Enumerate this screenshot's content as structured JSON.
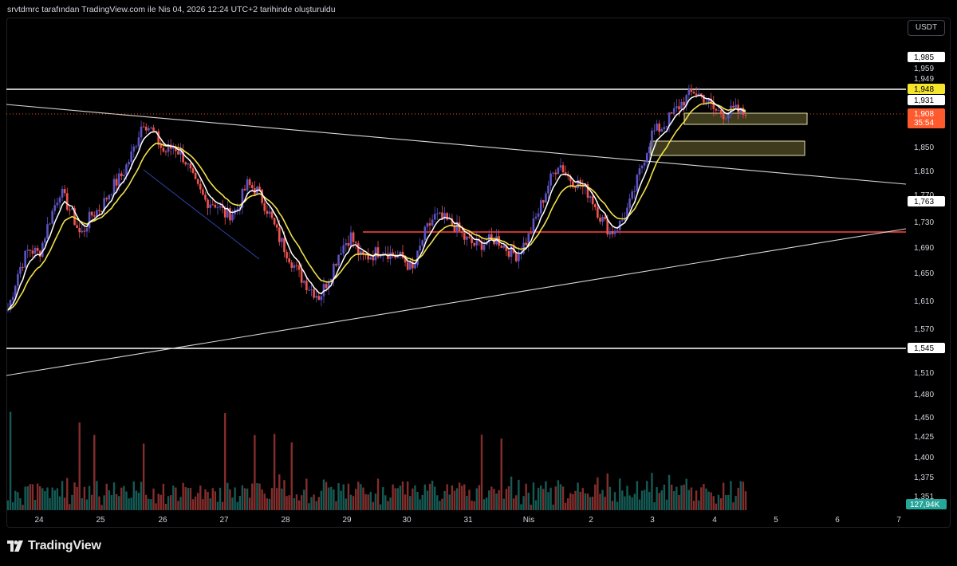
{
  "header": {
    "caption": "srvtdmrc tarafından TradingView.com ile Nis 04, 2026 12:24 UTC+2 tarihinde oluşturuldu"
  },
  "toolbar": {
    "currency": "USDT"
  },
  "price_axis": {
    "ticks": [
      "1,985",
      "1,959",
      "1,949",
      "1,931",
      "1,850",
      "1,810",
      "1,770",
      "1,730",
      "1,690",
      "1,650",
      "1,610",
      "1,570",
      "1,510",
      "1,480",
      "1,450",
      "1,425",
      "1,400",
      "1,375",
      "1,351"
    ],
    "labels": {
      "resistance": "1,948",
      "ema": "1,931",
      "last_price": "1,908",
      "countdown": "35:54",
      "trend_level": "1,763",
      "support": "1,545",
      "volume": "127,94K"
    }
  },
  "time_axis": [
    "24",
    "25",
    "26",
    "27",
    "28",
    "29",
    "30",
    "31",
    "Nis",
    "2",
    "3",
    "4",
    "5",
    "6",
    "7"
  ],
  "colors": {
    "background": "#000000",
    "up_candle": "#5d53c4",
    "down_candle": "#ef5350",
    "up_volume": "#26a69a",
    "down_volume": "#ef5350",
    "fast_ma": "#ffffff",
    "slow_ma": "#f2e14a",
    "horizontal_level": "#ffffff",
    "red_level": "#e53935",
    "last_price_line": "#ff5722",
    "zone_fill": "#3d3a1e",
    "zone_border": "#e8e0a8"
  },
  "branding": {
    "name": "TradingView",
    "icon": "tradingview-logo-icon"
  },
  "chart_data": {
    "type": "candlestick",
    "price_path_close": [
      1.605,
      1.665,
      1.7,
      1.692,
      1.745,
      1.79,
      1.76,
      1.72,
      1.752,
      1.765,
      1.795,
      1.815,
      1.85,
      1.9,
      1.88,
      1.85,
      1.86,
      1.84,
      1.8,
      1.775,
      1.77,
      1.752,
      1.76,
      1.8,
      1.79,
      1.76,
      1.72,
      1.69,
      1.66,
      1.64,
      1.625,
      1.66,
      1.7,
      1.72,
      1.685,
      1.69,
      1.7,
      1.69,
      1.685,
      1.665,
      1.72,
      1.75,
      1.745,
      1.735,
      1.715,
      1.705,
      1.71,
      1.716,
      1.7,
      1.69,
      1.715,
      1.755,
      1.8,
      1.835,
      1.81,
      1.8,
      1.785,
      1.75,
      1.725,
      1.74,
      1.775,
      1.83,
      1.88,
      1.89,
      1.91,
      1.93,
      1.945,
      1.935,
      1.915,
      1.91,
      1.915,
      1.908
    ],
    "last_price": 1.908,
    "horizontal_levels": [
      1.948,
      1.545,
      1.715
    ],
    "axis_labels": {
      "resistance": 1.948,
      "ema": 1.931,
      "last": 1.908,
      "trend_level": 1.763,
      "support": 1.545
    },
    "ylim": [
      1.51,
      1.99
    ],
    "x_categories": [
      "24",
      "25",
      "26",
      "27",
      "28",
      "29",
      "30",
      "31",
      "Nis",
      "2",
      "3",
      "4",
      "5",
      "6",
      "7"
    ],
    "volume_label": "127,94K"
  }
}
